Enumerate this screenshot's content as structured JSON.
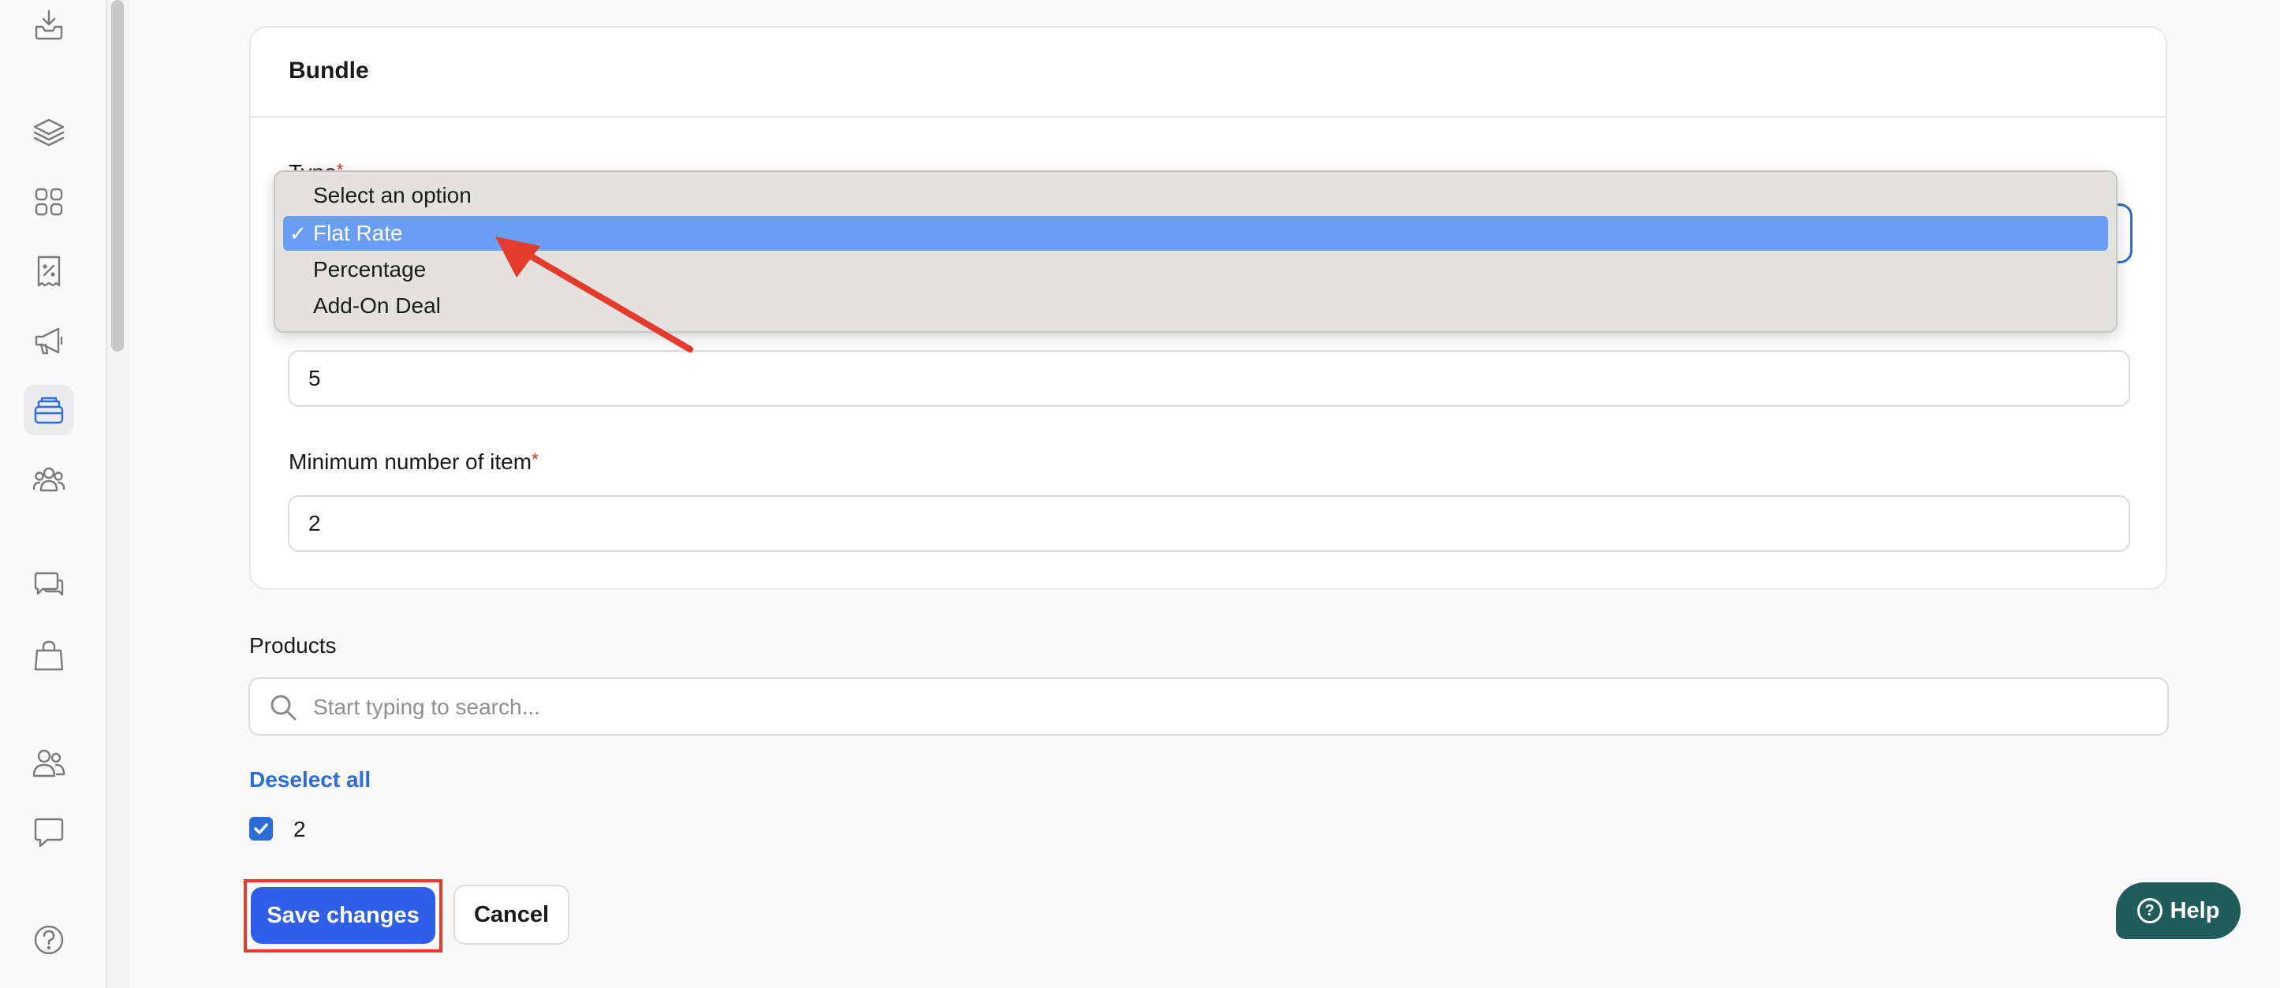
{
  "sidebar": {
    "items": [
      {
        "icon": "inbox-download-icon"
      },
      {
        "icon": "layers-icon"
      },
      {
        "icon": "grid-icon"
      },
      {
        "icon": "discount-receipt-icon"
      },
      {
        "icon": "megaphone-icon"
      },
      {
        "icon": "bundle-icon",
        "active": true
      },
      {
        "icon": "customers-group-icon"
      },
      {
        "icon": "chat-bubbles-icon"
      },
      {
        "icon": "shopping-bag-icon"
      },
      {
        "icon": "users-icon"
      },
      {
        "icon": "message-icon"
      },
      {
        "icon": "help-circle-icon"
      }
    ]
  },
  "bundle": {
    "title": "Bundle",
    "type_label": "Type",
    "required_mark": "*",
    "amount_value": "5",
    "min_items_label": "Minimum number of item",
    "min_items_value": "2"
  },
  "dropdown": {
    "options": [
      "Select an option",
      "Flat Rate",
      "Percentage",
      "Add-On Deal"
    ],
    "selected": "Flat Rate",
    "check_glyph": "✓"
  },
  "products": {
    "label": "Products",
    "search_placeholder": "Start typing to search...",
    "deselect_all": "Deselect all",
    "selected_item": "2",
    "selected_checked": true
  },
  "actions": {
    "save_label": "Save changes",
    "cancel_label": "Cancel"
  },
  "help": {
    "label": "Help"
  },
  "annotation_colors": {
    "arrow": "#e53b2c",
    "highlight": "#e53b2c"
  }
}
